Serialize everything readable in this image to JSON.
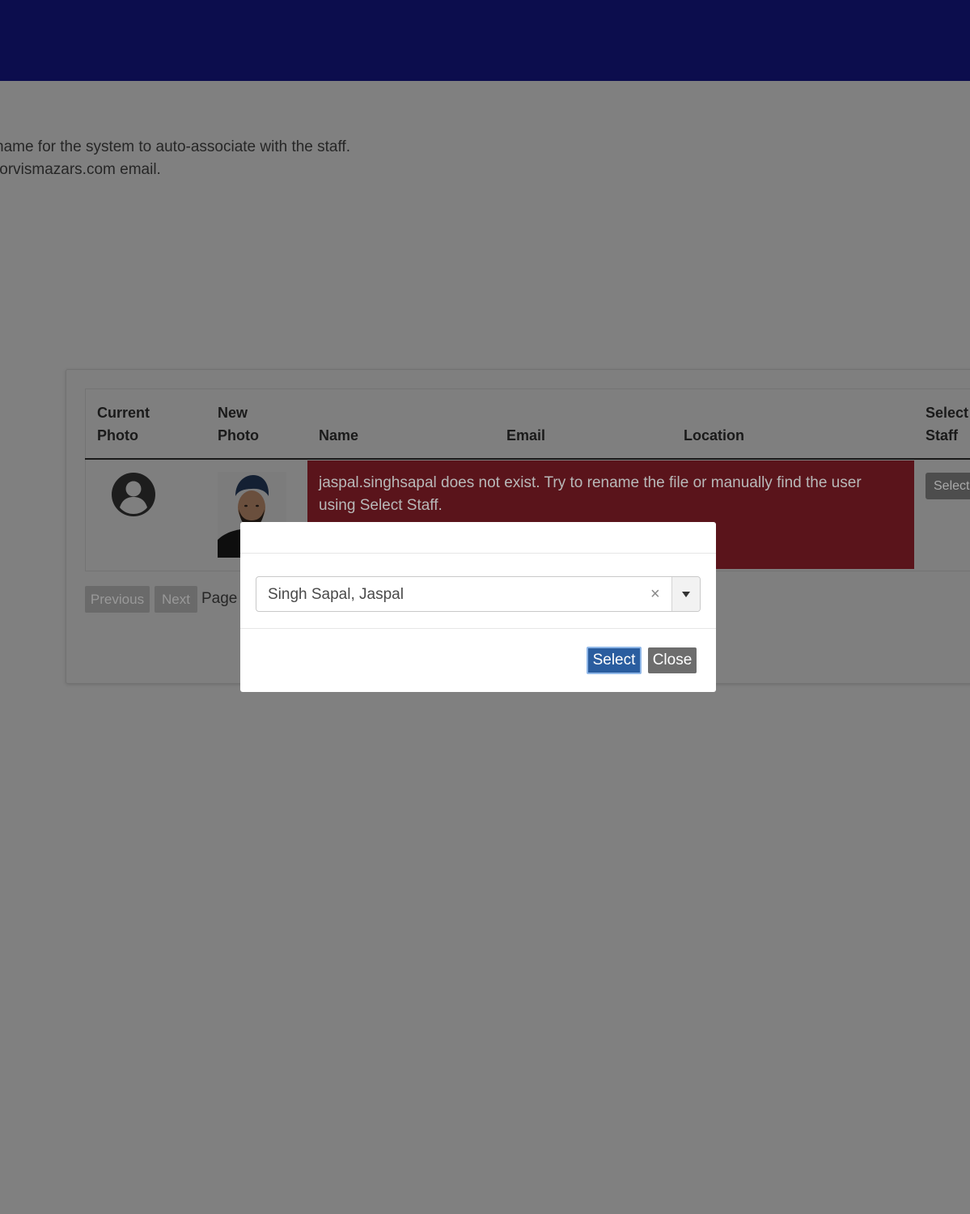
{
  "instructions": {
    "line1": "name for the system to auto-associate with the staff.",
    "line2": "forvismazars.com email."
  },
  "table": {
    "headers": {
      "current_photo": [
        "Current",
        "Photo"
      ],
      "new_photo": [
        "New",
        "Photo"
      ],
      "name": "Name",
      "email": "Email",
      "location": "Location",
      "select_staff": [
        "Select",
        "Staff"
      ]
    },
    "row": {
      "current_photo_icon": "user-circle-icon",
      "error_message": "jaspal.singhsapal does not exist. Try to rename the file or manually find the user using Select Staff.",
      "select_button_label": "Select"
    }
  },
  "pagination": {
    "previous_label": "Previous",
    "next_label": "Next",
    "page_label": "Page"
  },
  "modal": {
    "staff_select": {
      "value": "Singh Sapal, Jaspal",
      "clear_glyph": "×"
    },
    "select_button_label": "Select",
    "close_button_label": "Close"
  },
  "colors": {
    "topbar": "#0c0d4d",
    "error_cell": "#5a141b",
    "primary_button": "#2a5d9f"
  }
}
